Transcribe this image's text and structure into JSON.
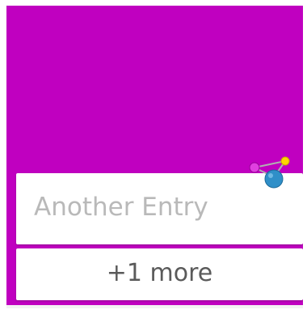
{
  "screen": {
    "background_color": "#c000c0"
  },
  "entry_card": {
    "label": "Another Entry"
  },
  "more_card": {
    "label": "+1 more"
  },
  "icons": {
    "app_icon": "molecule-icon"
  },
  "colors": {
    "card_background": "#ffffff",
    "entry_text": "#b9b9b9",
    "more_text": "#5a5a5a",
    "atom_magenta": "#e040e0",
    "atom_yellow": "#ffd600",
    "atom_blue": "#2f8fc8"
  }
}
